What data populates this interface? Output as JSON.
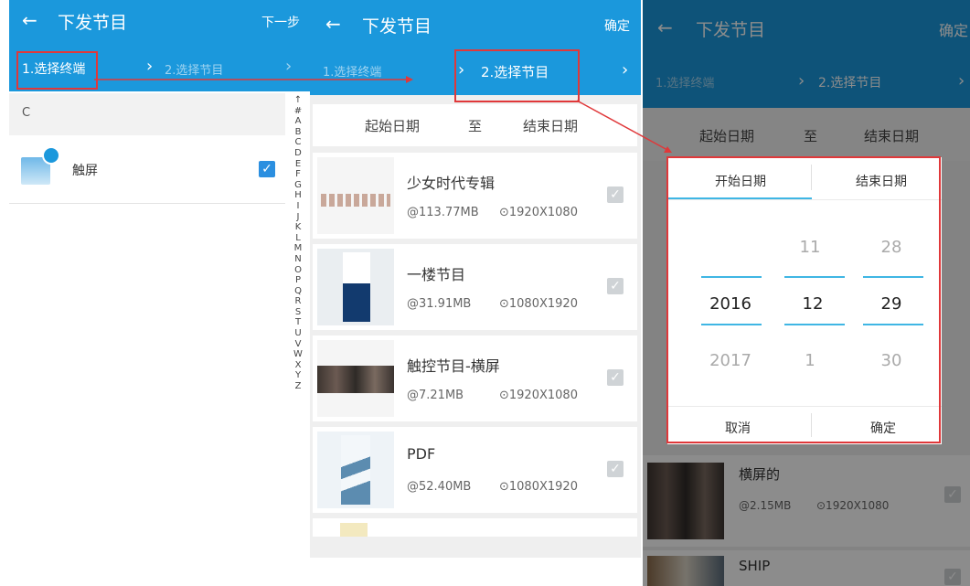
{
  "colors": {
    "accent": "#1b98dc",
    "annotation": "#e0383a",
    "checkbox_on": "#2b8fe0",
    "picker_line": "#3fb6e4"
  },
  "left_panel": {
    "back_icon": "←",
    "title": "下发节目",
    "action": "下一步",
    "step1": "1.选择终端",
    "step2": "2.选择节目",
    "chevron": "›",
    "section_letter": "C",
    "terminal": {
      "name": "触屏",
      "checked": true
    },
    "alphabet": [
      "↑",
      "#",
      "A",
      "B",
      "C",
      "D",
      "E",
      "F",
      "G",
      "H",
      "I",
      "J",
      "K",
      "L",
      "M",
      "N",
      "O",
      "P",
      "Q",
      "R",
      "S",
      "T",
      "U",
      "V",
      "W",
      "X",
      "Y",
      "Z"
    ]
  },
  "middle_panel": {
    "back_icon": "←",
    "title": "下发节目",
    "action": "确定",
    "step1": "1.选择终端",
    "step2": "2.选择节目",
    "date_start": "起始日期",
    "date_to": "至",
    "date_end": "结束日期",
    "programs": [
      {
        "title": "少女时代专辑",
        "size": "@113.77MB",
        "resolution": "⊙1920X1080"
      },
      {
        "title": "一楼节目",
        "size": "@31.91MB",
        "resolution": "⊙1080X1920"
      },
      {
        "title": "触控节目-横屏",
        "size": "@7.21MB",
        "resolution": "⊙1920X1080"
      },
      {
        "title": "PDF",
        "size": "@52.40MB",
        "resolution": "⊙1080X1920"
      }
    ]
  },
  "right_panel": {
    "back_icon": "←",
    "title": "下发节目",
    "action": "确定",
    "step1": "1.选择终端",
    "step2": "2.选择节目",
    "date_start": "起始日期",
    "date_to": "至",
    "date_end": "结束日期",
    "picker": {
      "tab_start": "开始日期",
      "tab_end": "结束日期",
      "years": [
        "",
        "2016",
        "2017"
      ],
      "months": [
        "11",
        "12",
        "1"
      ],
      "days": [
        "28",
        "29",
        "30"
      ],
      "cancel": "取消",
      "confirm": "确定"
    },
    "programs": [
      {
        "title": "横屏的",
        "size": "@2.15MB",
        "resolution": "⊙1920X1080"
      },
      {
        "title": "SHIP"
      }
    ]
  }
}
